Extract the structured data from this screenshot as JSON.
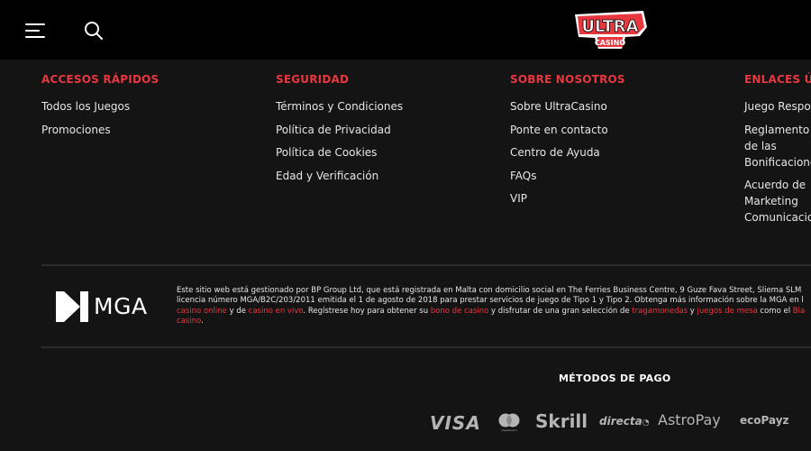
{
  "header": {
    "logo_top": "ULTRA",
    "logo_bottom": "CASINO"
  },
  "columns": [
    {
      "title": "ACCESOS RÁPIDOS",
      "items": [
        "Todos los Juegos",
        "Promociones"
      ]
    },
    {
      "title": "SEGURIDAD",
      "items": [
        "Términos y Condiciones",
        "Política de Privacidad",
        "Política de Cookies",
        "Edad y Verificación"
      ]
    },
    {
      "title": "SOBRE NOSOTROS",
      "items": [
        "Sobre UltraCasino",
        "Ponte en contacto",
        "Centro de Ayuda",
        "FAQs",
        "VIP"
      ]
    },
    {
      "title": "ENLACES ÚTILES",
      "items": [
        "Juego Responsable",
        "Reglamento de las Bonificaciones",
        "Acuerdo de Marketing Comunicaciones"
      ]
    }
  ],
  "license": {
    "mga_logo_text": "MGA",
    "text1": "Este sitio web está gestionado por BP Group Ltd, que está registrada en Malta con domicilio social en The Ferries Business Centre, 9 Guze Fava Street, Sliema SLM",
    "text2": "licencia número MGA/B2C/203/2011 emitida el 1 de agosto de 2018 para prestar servicios de juego de Tipo 1 y Tipo 2. Obtenga más información sobre la MGA en l",
    "link_casino_online": "casino online",
    "t_y_de": " y de ",
    "link_casino_en_vivo": "casino en vivo",
    "t_registrese": ". Regístrese hoy para obtener su ",
    "link_bono": "bono de casino",
    "t_disfrutar": " y disfrutar de una gran selección de ",
    "link_tragamonedas": "tragamonedas",
    "t_y": " y ",
    "link_juegos_mesa": "juegos de mesa",
    "t_como": " como el ",
    "link_black": "Bla",
    "link_casino_end": "casino",
    "t_end": "."
  },
  "payments": {
    "title": "MÉTODOS DE PAGO",
    "visa": "VISA",
    "mastercard_caption": "mastercard",
    "skrill": "Skrill",
    "directa": "directa",
    "astropay": "AstroPay",
    "ecopayz": "ecoPayz"
  },
  "colors": {
    "accent": "#e8373f",
    "background": "#141414",
    "header_bg": "#000000",
    "text": "#e6e6e6",
    "payment_logo": "#b5b5b5"
  }
}
